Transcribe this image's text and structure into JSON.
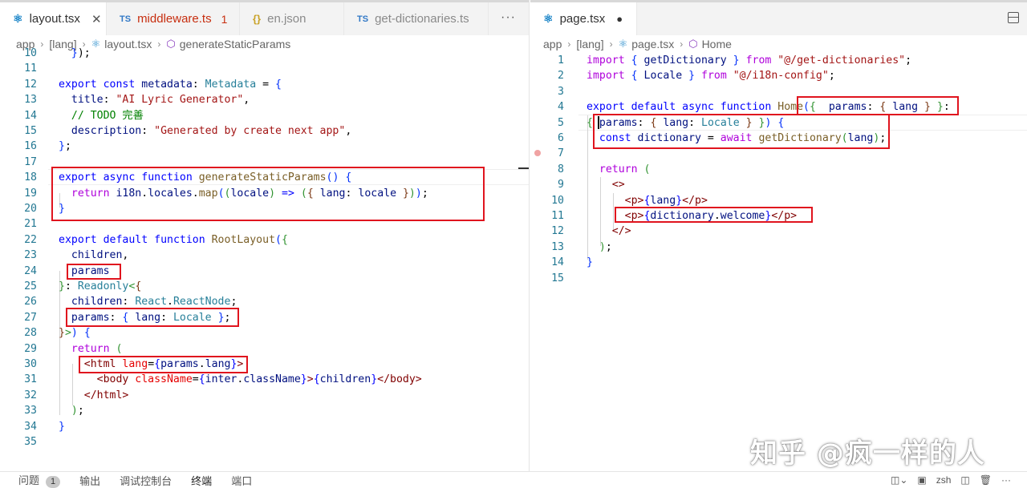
{
  "left": {
    "tabs": [
      {
        "icon": "react-icon",
        "label": "layout.tsx",
        "active": true,
        "close": "✕"
      },
      {
        "icon": "TS",
        "label": "middleware.ts",
        "badge": "1"
      },
      {
        "icon": "{}",
        "label": "en.json"
      },
      {
        "icon": "TS",
        "label": "get-dictionaries.ts"
      }
    ],
    "more": "···",
    "breadcrumb": [
      "app",
      "[lang]",
      "layout.tsx",
      "generateStaticParams"
    ],
    "lines": [
      {
        "n": "10",
        "tokens": [
          [
            "p",
            "  "
          ],
          [
            "br1",
            "}"
          ],
          [
            "p",
            ");"
          ]
        ]
      },
      {
        "n": "11",
        "tokens": []
      },
      {
        "n": "12",
        "tokens": [
          [
            "kw",
            "export"
          ],
          [
            "p",
            " "
          ],
          [
            "kw",
            "const"
          ],
          [
            "p",
            " "
          ],
          [
            "id",
            "metadata"
          ],
          [
            "p",
            ": "
          ],
          [
            "ty",
            "Metadata"
          ],
          [
            "p",
            " = "
          ],
          [
            "br1",
            "{"
          ]
        ]
      },
      {
        "n": "13",
        "tokens": [
          [
            "p",
            "  "
          ],
          [
            "id",
            "title"
          ],
          [
            "p",
            ": "
          ],
          [
            "str",
            "\"AI Lyric Generator\""
          ],
          [
            "p",
            ","
          ]
        ]
      },
      {
        "n": "14",
        "tokens": [
          [
            "p",
            "  "
          ],
          [
            "cmt",
            "// TODO 完善"
          ]
        ]
      },
      {
        "n": "15",
        "tokens": [
          [
            "p",
            "  "
          ],
          [
            "id",
            "description"
          ],
          [
            "p",
            ": "
          ],
          [
            "str",
            "\"Generated by create next app\""
          ],
          [
            "p",
            ","
          ]
        ]
      },
      {
        "n": "16",
        "tokens": [
          [
            "br1",
            "}"
          ],
          [
            "p",
            ";"
          ]
        ]
      },
      {
        "n": "17",
        "tokens": []
      },
      {
        "n": "18",
        "tokens": [
          [
            "kw",
            "export"
          ],
          [
            "p",
            " "
          ],
          [
            "kw",
            "async"
          ],
          [
            "p",
            " "
          ],
          [
            "kw",
            "function"
          ],
          [
            "p",
            " "
          ],
          [
            "fn",
            "generateStaticParams"
          ],
          [
            "br1",
            "()"
          ],
          [
            "p",
            " "
          ],
          [
            "br1",
            "{"
          ]
        ]
      },
      {
        "n": "19",
        "tokens": [
          [
            "p",
            "  "
          ],
          [
            "kw2",
            "return"
          ],
          [
            "p",
            " "
          ],
          [
            "id",
            "i18n"
          ],
          [
            "p",
            "."
          ],
          [
            "id",
            "locales"
          ],
          [
            "p",
            "."
          ],
          [
            "fn",
            "map"
          ],
          [
            "br1",
            "("
          ],
          [
            "br2",
            "("
          ],
          [
            "id",
            "locale"
          ],
          [
            "br2",
            ")"
          ],
          [
            "p",
            " "
          ],
          [
            "kw",
            "=>"
          ],
          [
            "p",
            " "
          ],
          [
            "br2",
            "("
          ],
          [
            "br3",
            "{"
          ],
          [
            "p",
            " "
          ],
          [
            "id",
            "lang"
          ],
          [
            "p",
            ": "
          ],
          [
            "id",
            "locale"
          ],
          [
            "p",
            " "
          ],
          [
            "br3",
            "}"
          ],
          [
            "br2",
            ")"
          ],
          [
            "br1",
            ")"
          ],
          [
            "p",
            ";"
          ]
        ]
      },
      {
        "n": "20",
        "tokens": [
          [
            "br1",
            "}"
          ]
        ]
      },
      {
        "n": "21",
        "tokens": []
      },
      {
        "n": "22",
        "tokens": [
          [
            "kw",
            "export"
          ],
          [
            "p",
            " "
          ],
          [
            "kw",
            "default"
          ],
          [
            "p",
            " "
          ],
          [
            "kw",
            "function"
          ],
          [
            "p",
            " "
          ],
          [
            "fn",
            "RootLayout"
          ],
          [
            "br1",
            "("
          ],
          [
            "br2",
            "{"
          ]
        ]
      },
      {
        "n": "23",
        "tokens": [
          [
            "p",
            "  "
          ],
          [
            "id",
            "children"
          ],
          [
            "p",
            ","
          ]
        ]
      },
      {
        "n": "24",
        "tokens": [
          [
            "p",
            "  "
          ],
          [
            "id",
            "params"
          ]
        ]
      },
      {
        "n": "25",
        "tokens": [
          [
            "br2",
            "}"
          ],
          [
            "p",
            ": "
          ],
          [
            "ty",
            "Readonly"
          ],
          [
            "br2",
            "<"
          ],
          [
            "br3",
            "{"
          ]
        ]
      },
      {
        "n": "26",
        "tokens": [
          [
            "p",
            "  "
          ],
          [
            "id",
            "children"
          ],
          [
            "p",
            ": "
          ],
          [
            "ty",
            "React"
          ],
          [
            "p",
            "."
          ],
          [
            "ty",
            "ReactNode"
          ],
          [
            "p",
            ";"
          ]
        ]
      },
      {
        "n": "27",
        "tokens": [
          [
            "p",
            "  "
          ],
          [
            "id",
            "params"
          ],
          [
            "p",
            ": "
          ],
          [
            "br1",
            "{"
          ],
          [
            "p",
            " "
          ],
          [
            "id",
            "lang"
          ],
          [
            "p",
            ": "
          ],
          [
            "ty",
            "Locale"
          ],
          [
            "p",
            " "
          ],
          [
            "br1",
            "}"
          ],
          [
            "p",
            ";"
          ]
        ]
      },
      {
        "n": "28",
        "tokens": [
          [
            "br3",
            "}"
          ],
          [
            "br2",
            ">"
          ],
          [
            "br1",
            ")"
          ],
          [
            "p",
            " "
          ],
          [
            "br1",
            "{"
          ]
        ]
      },
      {
        "n": "29",
        "tokens": [
          [
            "p",
            "  "
          ],
          [
            "kw2",
            "return"
          ],
          [
            "p",
            " "
          ],
          [
            "br2",
            "("
          ]
        ]
      },
      {
        "n": "30",
        "tokens": [
          [
            "p",
            "    "
          ],
          [
            "tag",
            "<html"
          ],
          [
            "p",
            " "
          ],
          [
            "attr",
            "lang"
          ],
          [
            "p",
            "="
          ],
          [
            "kw",
            "{"
          ],
          [
            "id",
            "params"
          ],
          [
            "p",
            "."
          ],
          [
            "id",
            "lang"
          ],
          [
            "kw",
            "}"
          ],
          [
            "tag",
            ">"
          ]
        ]
      },
      {
        "n": "31",
        "tokens": [
          [
            "p",
            "      "
          ],
          [
            "tag",
            "<body"
          ],
          [
            "p",
            " "
          ],
          [
            "attr",
            "className"
          ],
          [
            "p",
            "="
          ],
          [
            "kw",
            "{"
          ],
          [
            "id",
            "inter"
          ],
          [
            "p",
            "."
          ],
          [
            "id",
            "className"
          ],
          [
            "kw",
            "}"
          ],
          [
            "tag",
            ">"
          ],
          [
            "kw",
            "{"
          ],
          [
            "id",
            "children"
          ],
          [
            "kw",
            "}"
          ],
          [
            "tag",
            "</body>"
          ]
        ]
      },
      {
        "n": "32",
        "tokens": [
          [
            "p",
            "    "
          ],
          [
            "tag",
            "</html>"
          ]
        ]
      },
      {
        "n": "33",
        "tokens": [
          [
            "p",
            "  "
          ],
          [
            "br2",
            ")"
          ],
          [
            "p",
            ";"
          ]
        ]
      },
      {
        "n": "34",
        "tokens": [
          [
            "br1",
            "}"
          ]
        ]
      },
      {
        "n": "35",
        "tokens": []
      }
    ]
  },
  "right": {
    "tabs": [
      {
        "icon": "react-icon",
        "label": "page.tsx",
        "active": true,
        "dirty": "●"
      }
    ],
    "breadcrumb": [
      "app",
      "[lang]",
      "page.tsx",
      "Home"
    ],
    "lines": [
      {
        "n": "1",
        "tokens": [
          [
            "kw2",
            "import"
          ],
          [
            "p",
            " "
          ],
          [
            "br1",
            "{"
          ],
          [
            "p",
            " "
          ],
          [
            "id",
            "getDictionary"
          ],
          [
            "p",
            " "
          ],
          [
            "br1",
            "}"
          ],
          [
            "p",
            " "
          ],
          [
            "kw2",
            "from"
          ],
          [
            "p",
            " "
          ],
          [
            "str",
            "\"@/get-dictionaries\""
          ],
          [
            "p",
            ";"
          ]
        ]
      },
      {
        "n": "2",
        "tokens": [
          [
            "kw2",
            "import"
          ],
          [
            "p",
            " "
          ],
          [
            "br1",
            "{"
          ],
          [
            "p",
            " "
          ],
          [
            "id",
            "Locale"
          ],
          [
            "p",
            " "
          ],
          [
            "br1",
            "}"
          ],
          [
            "p",
            " "
          ],
          [
            "kw2",
            "from"
          ],
          [
            "p",
            " "
          ],
          [
            "str",
            "\"@/i18n-config\""
          ],
          [
            "p",
            ";"
          ]
        ]
      },
      {
        "n": "3",
        "tokens": []
      },
      {
        "n": "4",
        "tokens": [
          [
            "kw",
            "export"
          ],
          [
            "p",
            " "
          ],
          [
            "kw",
            "default"
          ],
          [
            "p",
            " "
          ],
          [
            "kw",
            "async"
          ],
          [
            "p",
            " "
          ],
          [
            "kw",
            "function"
          ],
          [
            "p",
            " "
          ],
          [
            "fn",
            "Home"
          ],
          [
            "br1",
            "("
          ],
          [
            "br2",
            "{"
          ],
          [
            "p",
            "  "
          ],
          [
            "id",
            "params"
          ],
          [
            "p",
            ": "
          ],
          [
            "br3",
            "{"
          ],
          [
            "p",
            " "
          ],
          [
            "id",
            "lang"
          ],
          [
            "p",
            " "
          ],
          [
            "br3",
            "}"
          ],
          [
            "p",
            " "
          ],
          [
            "br2",
            "}"
          ],
          [
            "p",
            ":"
          ]
        ]
      },
      {
        "n": "5",
        "tokens": [
          [
            "br2",
            "{"
          ],
          [
            "p",
            " "
          ],
          [
            "id",
            "params"
          ],
          [
            "p",
            ": "
          ],
          [
            "br3",
            "{"
          ],
          [
            "p",
            " "
          ],
          [
            "id",
            "lang"
          ],
          [
            "p",
            ": "
          ],
          [
            "ty",
            "Locale"
          ],
          [
            "p",
            " "
          ],
          [
            "br3",
            "}"
          ],
          [
            "p",
            " "
          ],
          [
            "br2",
            "}"
          ],
          [
            "br1",
            ")"
          ],
          [
            "p",
            " "
          ],
          [
            "br1",
            "{"
          ]
        ]
      },
      {
        "n": "6",
        "tokens": [
          [
            "p",
            "  "
          ],
          [
            "kw",
            "const"
          ],
          [
            "p",
            " "
          ],
          [
            "id",
            "dictionary"
          ],
          [
            "p",
            " = "
          ],
          [
            "kw2",
            "await"
          ],
          [
            "p",
            " "
          ],
          [
            "fn",
            "getDictionary"
          ],
          [
            "br2",
            "("
          ],
          [
            "id",
            "lang"
          ],
          [
            "br2",
            ")"
          ],
          [
            "p",
            ";"
          ]
        ]
      },
      {
        "n": "7",
        "tokens": []
      },
      {
        "n": "8",
        "tokens": [
          [
            "p",
            "  "
          ],
          [
            "kw2",
            "return"
          ],
          [
            "p",
            " "
          ],
          [
            "br2",
            "("
          ]
        ]
      },
      {
        "n": "9",
        "tokens": [
          [
            "p",
            "    "
          ],
          [
            "tag",
            "<>"
          ]
        ]
      },
      {
        "n": "10",
        "tokens": [
          [
            "p",
            "      "
          ],
          [
            "tag",
            "<p>"
          ],
          [
            "kw",
            "{"
          ],
          [
            "id",
            "lang"
          ],
          [
            "kw",
            "}"
          ],
          [
            "tag",
            "</p>"
          ]
        ]
      },
      {
        "n": "11",
        "tokens": [
          [
            "p",
            "      "
          ],
          [
            "tag",
            "<p>"
          ],
          [
            "kw",
            "{"
          ],
          [
            "id",
            "dictionary"
          ],
          [
            "p",
            "."
          ],
          [
            "id",
            "welcome"
          ],
          [
            "kw",
            "}"
          ],
          [
            "tag",
            "</p>"
          ]
        ]
      },
      {
        "n": "12",
        "tokens": [
          [
            "p",
            "    "
          ],
          [
            "tag",
            "</>"
          ]
        ]
      },
      {
        "n": "13",
        "tokens": [
          [
            "p",
            "  "
          ],
          [
            "br2",
            ")"
          ],
          [
            "p",
            ";"
          ]
        ]
      },
      {
        "n": "14",
        "tokens": [
          [
            "br1",
            "}"
          ]
        ]
      },
      {
        "n": "15",
        "tokens": []
      }
    ]
  },
  "panel": {
    "tabs": [
      "问题",
      "输出",
      "调试控制台",
      "终端",
      "端口"
    ],
    "problems_count": "1",
    "active_tab": "终端",
    "terminal_name": "zsh"
  },
  "watermark": "知乎 @疯一样的人",
  "colors": {
    "highlight_box": "#e0141e",
    "keyword": "#0000ff",
    "control_keyword": "#af00db",
    "string": "#a31515",
    "comment": "#008000",
    "function": "#795e26",
    "identifier": "#001080",
    "type": "#267f99",
    "tag": "#800000",
    "attribute": "#e50000",
    "line_number": "#237893"
  }
}
